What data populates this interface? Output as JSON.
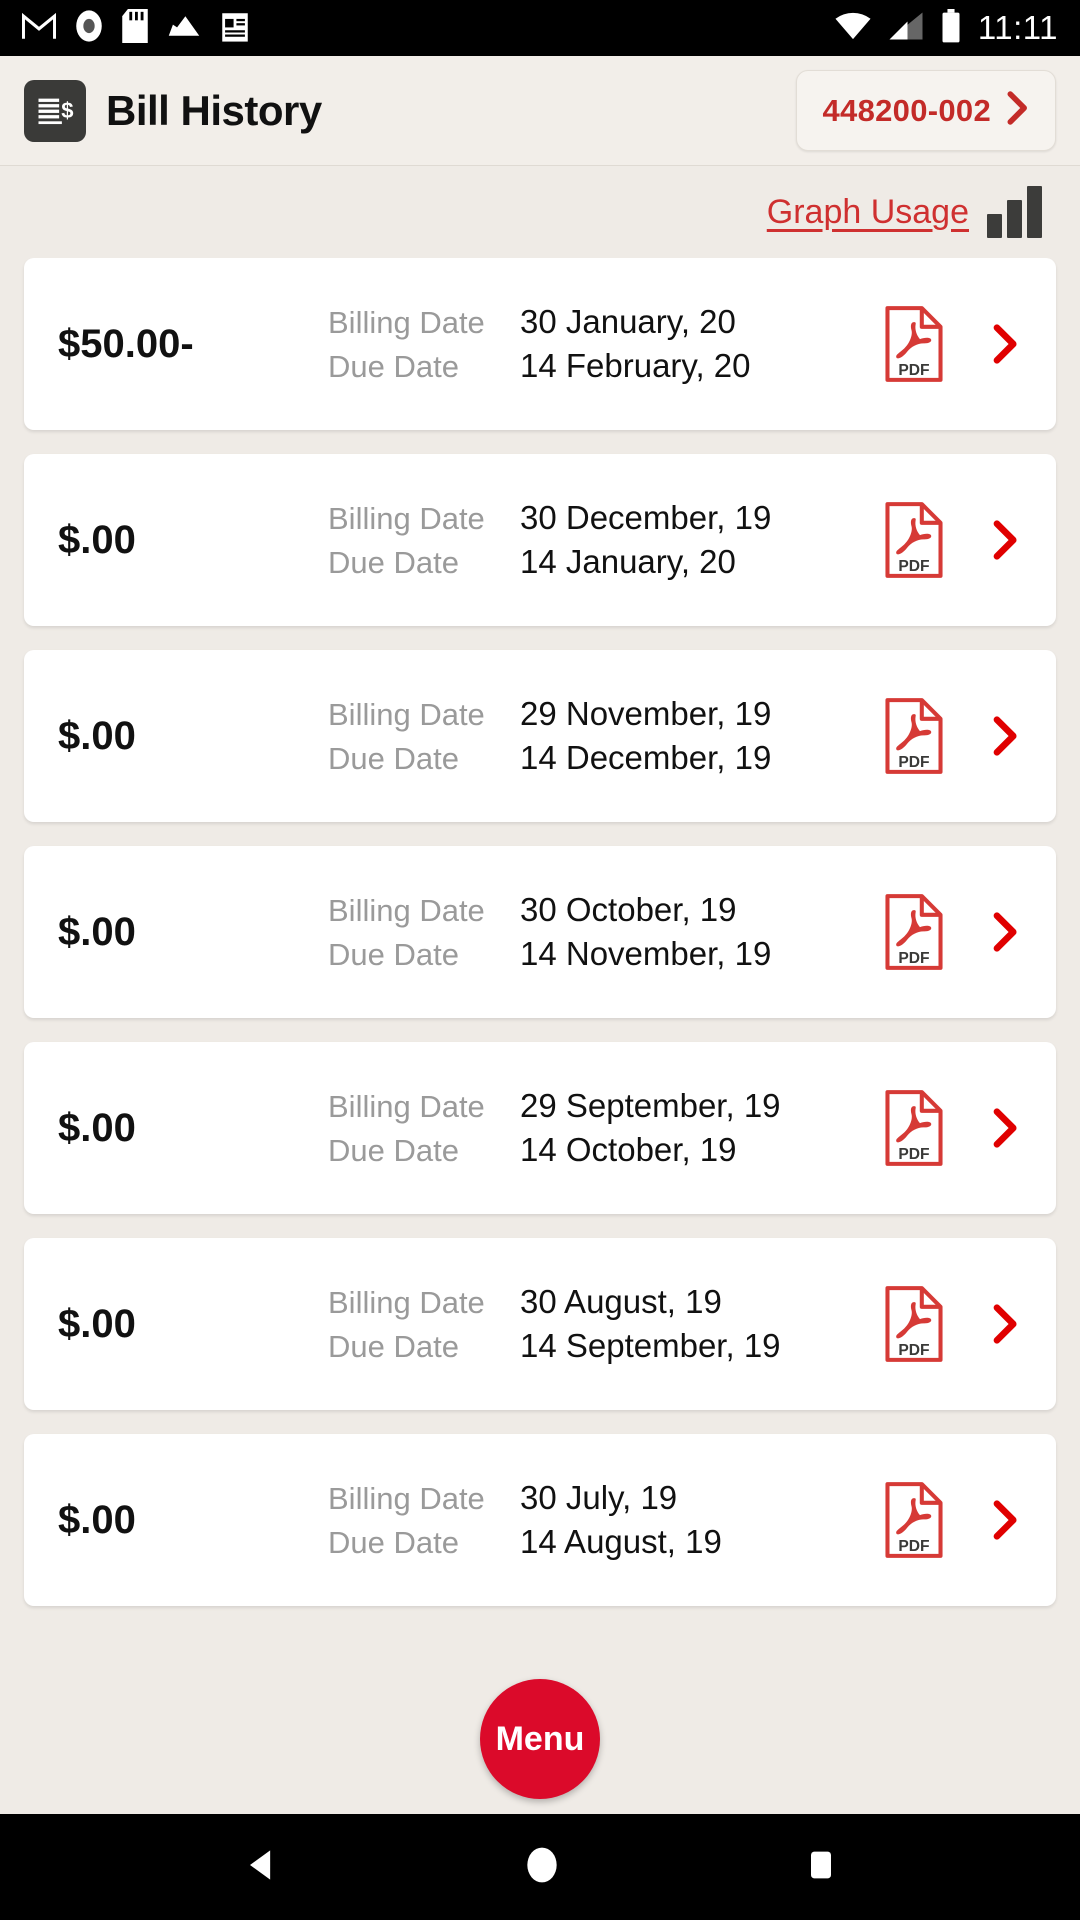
{
  "statusbar": {
    "time": "11:11",
    "left_icons": [
      "gmail-icon",
      "record-icon",
      "sd-card-icon",
      "cloud-icon",
      "news-icon"
    ],
    "right_icons": [
      "wifi-icon",
      "cell-signal-icon",
      "battery-icon"
    ]
  },
  "header": {
    "title": "Bill History",
    "icon": "bill-document-icon",
    "account_number": "448200-002",
    "account_chevron": "chevron-right-icon"
  },
  "usage": {
    "link_label": "Graph Usage",
    "icon": "bar-chart-icon"
  },
  "bills": [
    {
      "amount": "$50.00-",
      "billing_label": "Billing Date",
      "billing_date": "30 January, 20",
      "due_label": "Due Date",
      "due_date": "14 February, 20"
    },
    {
      "amount": "$.00",
      "billing_label": "Billing Date",
      "billing_date": "30 December, 19",
      "due_label": "Due Date",
      "due_date": "14 January, 20"
    },
    {
      "amount": "$.00",
      "billing_label": "Billing Date",
      "billing_date": "29 November, 19",
      "due_label": "Due Date",
      "due_date": "14 December, 19"
    },
    {
      "amount": "$.00",
      "billing_label": "Billing Date",
      "billing_date": "30 October, 19",
      "due_label": "Due Date",
      "due_date": "14 November, 19"
    },
    {
      "amount": "$.00",
      "billing_label": "Billing Date",
      "billing_date": "29 September, 19",
      "due_label": "Due Date",
      "due_date": "14 October, 19"
    },
    {
      "amount": "$.00",
      "billing_label": "Billing Date",
      "billing_date": "30 August, 19",
      "due_label": "Due Date",
      "due_date": "14 September, 19"
    },
    {
      "amount": "$.00",
      "billing_label": "Billing Date",
      "billing_date": "30 July, 19",
      "due_label": "Due Date",
      "due_date": "14 August, 19"
    }
  ],
  "row_icons": {
    "pdf": "pdf-file-icon",
    "chevron": "chevron-right-icon"
  },
  "fab": {
    "label": "Menu"
  },
  "navbar": {
    "back": "back-triangle-icon",
    "home": "home-circle-icon",
    "recents": "recents-square-icon"
  },
  "colors": {
    "background": "#EFEBE6",
    "card": "#FFFFFF",
    "accent_red": "#C32B28",
    "link_red": "#CF3030",
    "chevron_red": "#E00000",
    "fab_red": "#DB0A2A",
    "label_gray": "#9A9A9A",
    "icon_dark": "#3A3A38"
  }
}
